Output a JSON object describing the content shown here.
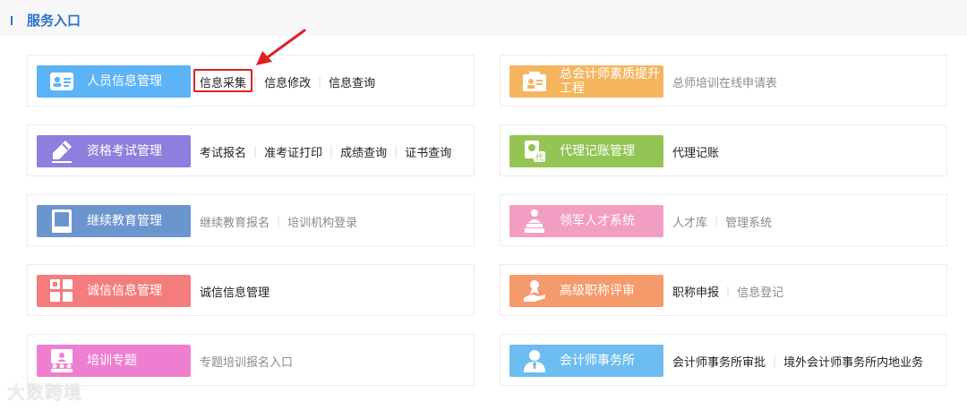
{
  "header": {
    "title": "服务入口"
  },
  "cards": [
    {
      "name": "人员信息管理",
      "color": "#5cb3f5",
      "icon": "id-card-icon",
      "links": [
        {
          "text": "信息采集",
          "style": "dark"
        },
        {
          "text": "信息修改",
          "style": "dark"
        },
        {
          "text": "信息查询",
          "style": "dark"
        }
      ]
    },
    {
      "name": "总会计师素质提升工程",
      "color": "#f5b55f",
      "icon": "certificate-icon",
      "links": [
        {
          "text": "总师培训在线申请表",
          "style": "muted"
        }
      ]
    },
    {
      "name": "资格考试管理",
      "color": "#8d7fde",
      "icon": "pen-icon",
      "links": [
        {
          "text": "考试报名",
          "style": "dark"
        },
        {
          "text": "准考证打印",
          "style": "dark"
        },
        {
          "text": "成绩查询",
          "style": "dark"
        },
        {
          "text": "证书查询",
          "style": "dark"
        }
      ]
    },
    {
      "name": "代理记账管理",
      "color": "#93c454",
      "icon": "agent-document-icon",
      "links": [
        {
          "text": "代理记账",
          "style": "dark"
        }
      ]
    },
    {
      "name": "继续教育管理",
      "color": "#6b95cf",
      "icon": "book-icon",
      "links": [
        {
          "text": "继续教育报名",
          "style": "muted"
        },
        {
          "text": "培训机构登录",
          "style": "muted"
        }
      ]
    },
    {
      "name": "领军人才系统",
      "color": "#f29ec3",
      "icon": "podium-person-icon",
      "links": [
        {
          "text": "人才库",
          "style": "muted"
        },
        {
          "text": "管理系统",
          "style": "muted"
        }
      ]
    },
    {
      "name": "诚信信息管理",
      "color": "#f47c7c",
      "icon": "grid-icon",
      "links": [
        {
          "text": "诚信信息管理",
          "style": "dark"
        }
      ]
    },
    {
      "name": "高级职称评审",
      "color": "#f59a6a",
      "icon": "award-hand-icon",
      "links": [
        {
          "text": "职称申报",
          "style": "dark"
        },
        {
          "text": "信息登记",
          "style": "muted"
        }
      ]
    },
    {
      "name": "培训专题",
      "color": "#ee7fd0",
      "icon": "presentation-icon",
      "links": [
        {
          "text": "专题培训报名入口",
          "style": "muted"
        }
      ]
    },
    {
      "name": "会计师事务所",
      "color": "#6dbdf0",
      "icon": "person-icon",
      "links": [
        {
          "text": "会计师事务所审批",
          "style": "dark"
        },
        {
          "text": "境外会计师事务所内地业务",
          "style": "dark"
        }
      ]
    }
  ],
  "watermark": "大数跨境"
}
